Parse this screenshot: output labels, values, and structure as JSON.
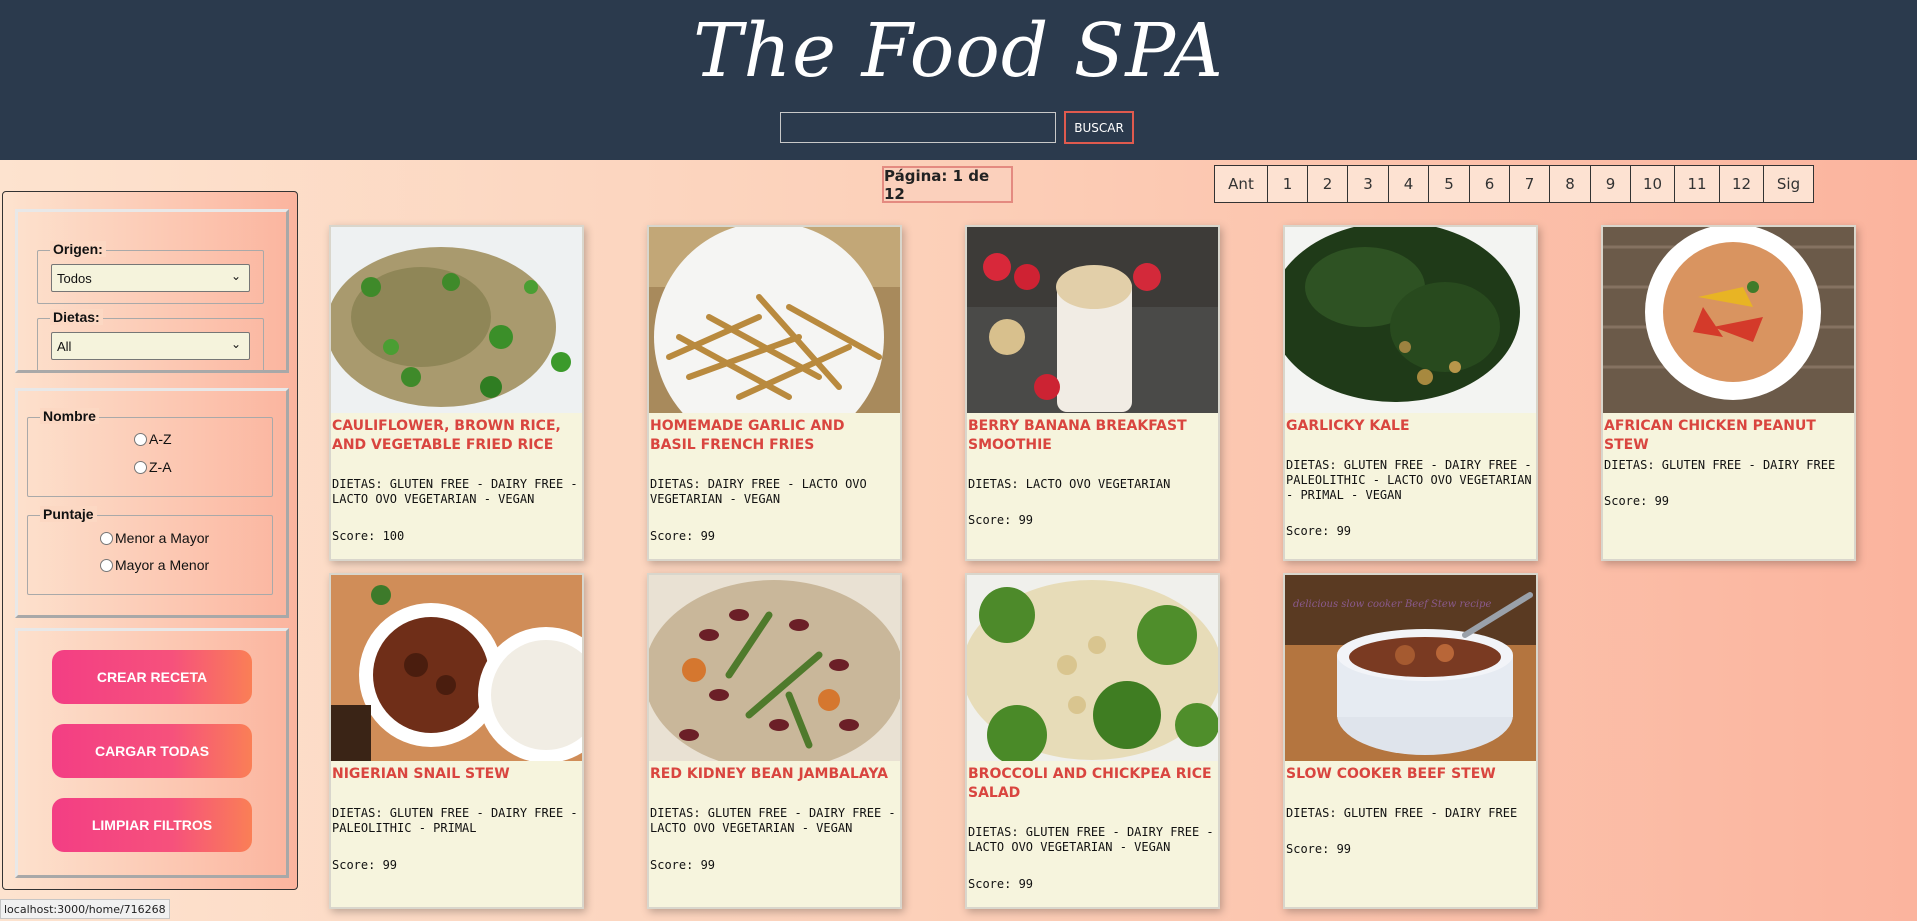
{
  "header": {
    "title": "The Food SPA",
    "search_value": "",
    "search_button": "BUSCAR"
  },
  "pagination": {
    "indicator": "Página: 1 de 12",
    "prev": "Ant",
    "pages": [
      "1",
      "2",
      "3",
      "4",
      "5",
      "6",
      "7",
      "8",
      "9",
      "10",
      "11",
      "12"
    ],
    "next": "Sig"
  },
  "sidebar": {
    "origen": {
      "label": "Origen:",
      "selected": "Todos"
    },
    "dietas": {
      "label": "Dietas:",
      "selected": "All"
    },
    "nombre": {
      "label": "Nombre",
      "options": [
        "A-Z",
        "Z-A"
      ]
    },
    "puntaje": {
      "label": "Puntaje",
      "options": [
        "Menor a Mayor",
        "Mayor a Menor"
      ]
    },
    "buttons": {
      "create": "CREAR RECETA",
      "load_all": "CARGAR TODAS",
      "clear": "LIMPIAR FILTROS"
    }
  },
  "recipes": [
    {
      "title": "Cauliflower, Brown Rice, and Vegetable Fried Rice",
      "diets": "Dietas: gluten free - dairy free - lacto ovo vegetarian - vegan",
      "score": "Score: 100"
    },
    {
      "title": "Homemade Garlic and Basil French Fries",
      "diets": "Dietas: dairy free - lacto ovo vegetarian - vegan",
      "score": "Score: 99"
    },
    {
      "title": "Berry Banana Breakfast Smoothie",
      "diets": "Dietas: lacto ovo vegetarian",
      "score": "Score: 99"
    },
    {
      "title": "Garlicky Kale",
      "diets": "Dietas: gluten free - dairy free - paleolithic - lacto ovo vegetarian - primal - vegan",
      "score": "Score: 99"
    },
    {
      "title": "African Chicken Peanut Stew",
      "diets": "Dietas: gluten free - dairy free",
      "score": "Score: 99"
    },
    {
      "title": "Nigerian Snail Stew",
      "diets": "Dietas: gluten free - dairy free - paleolithic - primal",
      "score": "Score: 99"
    },
    {
      "title": "Red Kidney Bean Jambalaya",
      "diets": "Dietas: gluten free - dairy free - lacto ovo vegetarian - vegan",
      "score": "Score: 99"
    },
    {
      "title": "Broccoli and Chickpea Rice Salad",
      "diets": "Dietas: gluten free - dairy free - lacto ovo vegetarian - vegan",
      "score": "Score: 99"
    },
    {
      "title": "Slow Cooker Beef Stew",
      "diets": "Dietas: gluten free - dairy free",
      "score": "Score: 99"
    }
  ],
  "image_texts": {
    "beef_stew_overlay": "delicious slow cooker Beef Stew recipe"
  },
  "status_url": "localhost:3000/home/716268"
}
